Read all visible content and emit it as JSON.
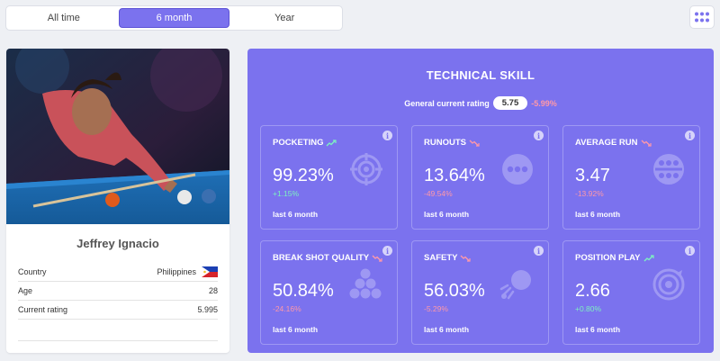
{
  "tabs": [
    {
      "label": "All time",
      "active": false
    },
    {
      "label": "6 month",
      "active": true
    },
    {
      "label": "Year",
      "active": false
    }
  ],
  "menu_button": {
    "icon": "grid-dots-icon"
  },
  "player": {
    "name": "Jeffrey Ignacio",
    "rows": [
      {
        "label": "Country",
        "value": "Philippines",
        "flag": "philippines-flag-icon"
      },
      {
        "label": "Age",
        "value": "28"
      },
      {
        "label": "Current rating",
        "value": "5.995"
      }
    ]
  },
  "skill": {
    "title": "TECHNICAL SKILL",
    "rating_label": "General current rating",
    "rating_value": "5.75",
    "rating_change": "-5.99%",
    "cards": [
      {
        "title": "POCKETING",
        "value": "99.23%",
        "delta": "+1.15%",
        "trend": "up",
        "period": "last 6 month",
        "icon": "target-icon"
      },
      {
        "title": "RUNOUTS",
        "value": "13.64%",
        "delta": "-49.54%",
        "trend": "down",
        "period": "last 6 month",
        "icon": "three-dots-icon"
      },
      {
        "title": "AVERAGE RUN",
        "value": "3.47",
        "delta": "-13.92%",
        "trend": "down",
        "period": "last 6 month",
        "icon": "balls-in-row-icon"
      },
      {
        "title": "BREAK SHOT QUALITY",
        "value": "50.84%",
        "delta": "-24.16%",
        "trend": "down",
        "period": "last 6 month",
        "icon": "rack-icon"
      },
      {
        "title": "SAFETY",
        "value": "56.03%",
        "delta": "-5.29%",
        "trend": "down",
        "period": "last 6 month",
        "icon": "ball-strike-icon"
      },
      {
        "title": "POSITION PLAY",
        "value": "2.66",
        "delta": "+0.80%",
        "trend": "up",
        "period": "last 6 month",
        "icon": "position-target-icon"
      }
    ]
  },
  "colors": {
    "accent": "#7b72ee",
    "positive": "#7df2c0",
    "negative": "#ff98a8"
  }
}
